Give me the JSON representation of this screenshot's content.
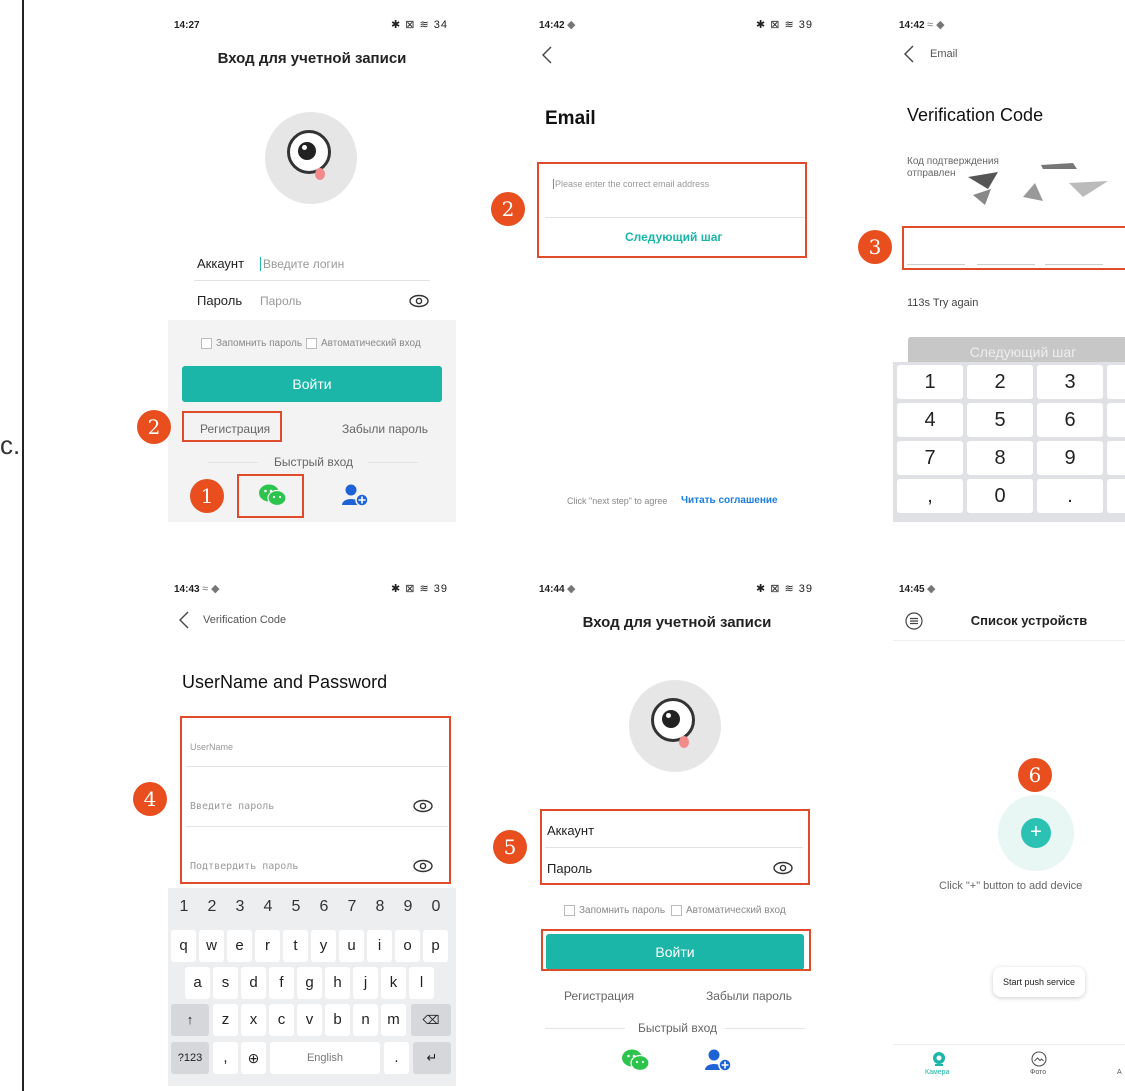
{
  "side_char": "с.",
  "badges": {
    "b1": "1",
    "b2": "2",
    "b3": "3",
    "b4": "4",
    "b5": "5",
    "b6": "6"
  },
  "colors": {
    "accent_teal": "#1bb6a8",
    "highlight_red": "#e04b2b",
    "badge_orange": "#e84e1e"
  },
  "screen1": {
    "time": "14:27",
    "status_icons": "✱ ⊠ ≋ 34",
    "title": "Вход для учетной записи",
    "account_label": "Аккаунт",
    "account_placeholder": "Введите логин",
    "password_label": "Пароль",
    "password_placeholder": "Пароль",
    "remember": "Запомнить пароль",
    "auto_login": "Автоматический вход",
    "login_button": "Войти",
    "register": "Регистрация",
    "forgot": "Забыли пароль",
    "quick_login": "Быстрый вход"
  },
  "screen2": {
    "time": "14:42",
    "status_icons": "✱ ⊠ ≋ 39",
    "title": "Email",
    "email_placeholder": "Please enter the correct email address",
    "next_step": "Следующий шаг",
    "agree_text": "Click \"next step\" to agree",
    "agree_link": "Читать соглашение"
  },
  "screen3": {
    "time": "14:42",
    "back_label": "Email",
    "title": "Verification Code",
    "sent_line1": "Код подтверждения",
    "sent_line2": "отправлен",
    "retry": "113s Try again",
    "next_step": "Следующий шаг",
    "keys": [
      "1",
      "2",
      "3",
      "4",
      "5",
      "6",
      "7",
      "8",
      "9",
      ",",
      "0",
      "."
    ]
  },
  "screen4": {
    "time": "14:43",
    "status_icons": "✱ ⊠ ≋ 39",
    "back_label": "Verification Code",
    "title": "UserName and Password",
    "username_placeholder": "UserName",
    "password_placeholder": "Введите пароль",
    "confirm_placeholder": "Подтвердить пароль",
    "number_row": [
      "1",
      "2",
      "3",
      "4",
      "5",
      "6",
      "7",
      "8",
      "9",
      "0"
    ],
    "row1": [
      "q",
      "w",
      "e",
      "r",
      "t",
      "y",
      "u",
      "i",
      "o",
      "p"
    ],
    "row2": [
      "a",
      "s",
      "d",
      "f",
      "g",
      "h",
      "j",
      "k",
      "l"
    ],
    "row3": [
      "z",
      "x",
      "c",
      "v",
      "b",
      "n",
      "m"
    ],
    "sym_key": "?123",
    "comma_key": ",",
    "space_key": "English",
    "period_key": "."
  },
  "screen5": {
    "time": "14:44",
    "status_icons": "✱ ⊠ ≋ 39",
    "title": "Вход для учетной записи",
    "account_label": "Аккаунт",
    "password_label": "Пароль",
    "remember": "Запомнить пароль",
    "auto_login": "Автоматический вход",
    "login_button": "Войти",
    "register": "Регистрация",
    "forgot": "Забыли пароль",
    "quick_login": "Быстрый вход"
  },
  "screen6": {
    "time": "14:45",
    "title": "Список устройств",
    "add_hint": "Click \"+\" button to add device",
    "push_service": "Start push service",
    "tab_camera": "Камера",
    "tab_photo": "Фото",
    "tab_third": "A"
  }
}
